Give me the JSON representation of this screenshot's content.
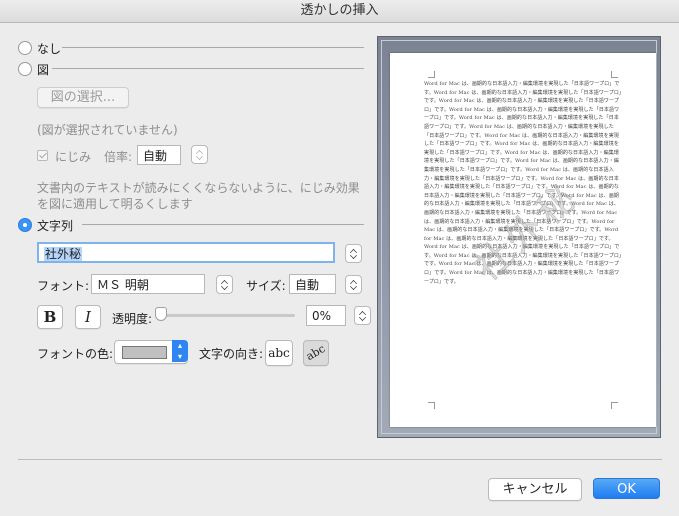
{
  "window": {
    "title": "透かしの挿入"
  },
  "options": {
    "none_label": "なし",
    "picture_label": "図",
    "select_picture_button": "図の選択...",
    "no_picture_text": "(図が選択されていません)",
    "washout_label": "にじみ",
    "scale_label": "倍率:",
    "scale_value": "自動",
    "description": "文書内のテキストが読みにくくならないように、にじみ効果を図に適用して明るくします",
    "text_label": "文字列",
    "text_value": "社外秘"
  },
  "format": {
    "font_label": "フォント:",
    "font_value": "ＭＳ 明朝",
    "size_label": "サイズ:",
    "size_value": "自動",
    "bold_label": "B",
    "italic_label": "I",
    "transparency_label": "透明度:",
    "transparency_value": "0%",
    "transparency_level": 0,
    "font_color_label": "フォントの色:",
    "font_color": "#c0c0c0",
    "orientation_label": "文字の向き:",
    "orientation_horizontal": "abc",
    "orientation_diagonal": "abc"
  },
  "preview": {
    "body_text": "Word for Mac は、画期的な日本語入力・編集環境を実現した「日本語ワープロ」です。Word for Mac は、画期的な日本語入力・編集環境を実現した「日本語ワープロ」です。Word for Mac は、画期的な日本語入力・編集環境を実現した「日本語ワープロ」です。Word for Mac は、画期的な日本語入力・編集環境を実現した「日本語ワープロ」です。Word for Mac は、画期的な日本語入力・編集環境を実現した「日本語ワープロ」です。Word for Mac は、画期的な日本語入力・編集環境を実現した「日本語ワープロ」です。Word for Mac は、画期的な日本語入力・編集環境を実現した「日本語ワープロ」です。Word for Mac は、画期的な日本語入力・編集環境を実現した「日本語ワープロ」です。Word for Mac は、画期的な日本語入力・編集環境を実現した「日本語ワープロ」です。Word for Mac は、画期的な日本語入力・編集環境を実現した「日本語ワープロ」です。Word for Mac は、画期的な日本語入力・編集環境を実現した「日本語ワープロ」です。Word for Mac は、画期的な日本語入力・編集環境を実現した「日本語ワープロ」です。Word for Mac は、画期的な日本語入力・編集環境を実現した「日本語ワープロ」です。Word for Mac は、画期的な日本語入力・編集環境を実現した「日本語ワープロ」です。Word for Mac は、画期的な日本語入力・編集環境を実現した「日本語ワープロ」です。Word for Mac は、画期的な日本語入力・編集環境を実現した「日本語ワープロ」です。Word for Mac は、画期的な日本語入力・編集環境を実現した「日本語ワープロ」です。Word for Mac は、画期的な日本語入力・編集環境を実現した「日本語ワープロ」です。Word for Mac は、画期的な日本語入力・編集環境を実現した「日本語ワープロ」です。Word for Mac は、画期的な日本語入力・編集環境を実現した「日本語ワープロ」です。Word for Mac は、画期的な日本語入力・編集環境を実現した「日本語ワープロ」です。Word for Mac は、画期的な日本語入力・編集環境を実現した「日本語ワープロ」です。",
    "watermark_text": "社外秘"
  },
  "actions": {
    "cancel_label": "キャンセル",
    "ok_label": "OK"
  }
}
